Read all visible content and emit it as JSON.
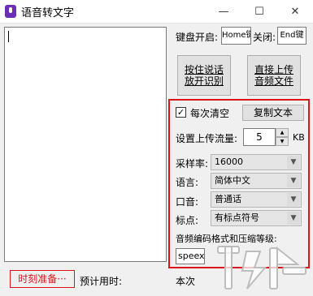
{
  "window": {
    "title": "语音转文字",
    "minimize": "—",
    "maximize": "☐",
    "close": "✕"
  },
  "hotkeys": {
    "start_label": "键盘开启:",
    "start_key": "Home键",
    "stop_label": "关闭:",
    "stop_key": "End键"
  },
  "buttons": {
    "press_to_talk": [
      "按住说话",
      "放开识别"
    ],
    "upload_audio": [
      "直接上传",
      "音频文件"
    ],
    "copy_text": "复制文本"
  },
  "settings": {
    "clear_each_time": {
      "label": "每次清空",
      "checked": true
    },
    "upload_flow": {
      "label": "设置上传流量:",
      "value": "5",
      "unit": "KB"
    },
    "sample_rate": {
      "label": "采样率:",
      "value": "16000"
    },
    "language": {
      "label": "语言:",
      "value": "简体中文"
    },
    "accent": {
      "label": "口音:",
      "value": "普通话"
    },
    "punctuation": {
      "label": "标点:",
      "value": "有标点符号"
    },
    "codec": {
      "label": "音频编码格式和压缩等级:",
      "value": "speex"
    }
  },
  "status": {
    "timer": "时刻准备···",
    "estimated_label": "预计用时:",
    "this_time_label": "本次"
  },
  "watermark": "下载吧"
}
